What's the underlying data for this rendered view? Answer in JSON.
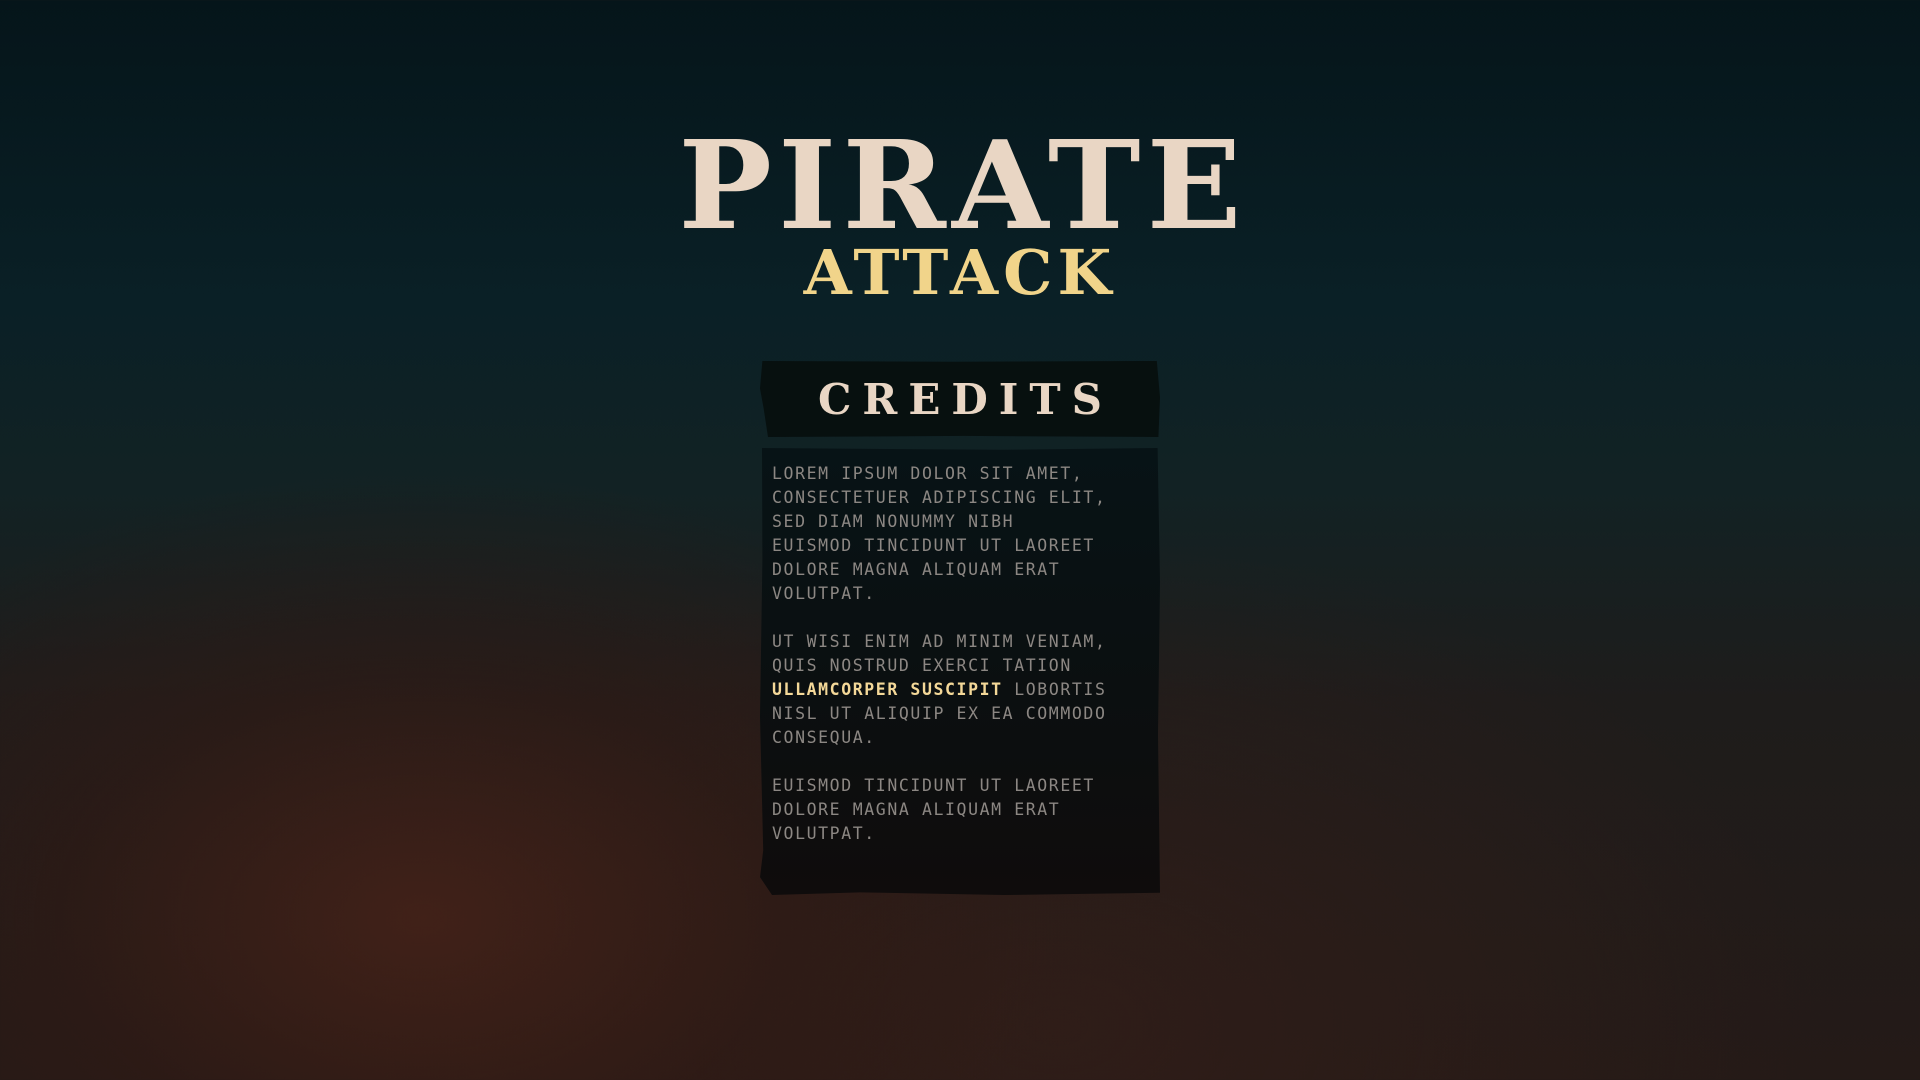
{
  "colors": {
    "title_cream": "#e9d6c4",
    "title_gold": "#f1d48a",
    "body_text": "#8c8783",
    "highlight": "#f4d898"
  },
  "title": {
    "main": "PIRATE",
    "sub": "ATTACK"
  },
  "credits": {
    "heading": "CREDITS",
    "paragraphs": [
      {
        "lines": [
          "LOREM IPSUM DOLOR SIT AMET,",
          "CONSECTETUER ADIPISCING ELIT,",
          "SED DIAM NONUMMY NIBH",
          "EUISMOD TINCIDUNT UT LAOREET",
          "DOLORE MAGNA ALIQUAM ERAT",
          "VOLUTPAT."
        ]
      },
      {
        "lines": [
          "UT WISI ENIM AD MINIM VENIAM,",
          "QUIS NOSTRUD EXERCI TATION"
        ],
        "highlight": "ULLAMCORPER SUSCIPIT",
        "highlight_tail": " LOBORTIS",
        "after_lines": [
          "NISL UT ALIQUIP EX EA COMMODO",
          "CONSEQUA."
        ]
      },
      {
        "lines": [
          "EUISMOD TINCIDUNT UT LAOREET",
          "DOLORE MAGNA ALIQUAM ERAT",
          "VOLUTPAT."
        ]
      }
    ]
  }
}
